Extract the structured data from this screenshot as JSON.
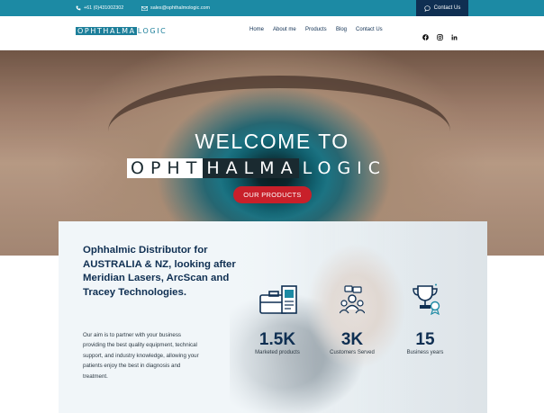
{
  "topbar": {
    "phone": "+61 (0)431002302",
    "email": "sales@ophthalmologic.com",
    "contact_button": "Contact Us"
  },
  "header": {
    "logo_dark": "OPHTHALMA",
    "logo_light": "LOGIC",
    "nav": [
      "Home",
      "About me",
      "Products",
      "Blog",
      "Contact Us"
    ],
    "social": [
      "facebook-icon",
      "instagram-icon",
      "linkedin-icon"
    ]
  },
  "hero": {
    "welcome": "WELCOME TO",
    "brand_white": "OPHT",
    "brand_dark": "HALMA",
    "brand_tail": "LOGIC",
    "cta": "OUR PRODUCTS"
  },
  "about": {
    "headline": "Ophhalmic Distributor for AUSTRALIA & NZ, looking after Meridian Lasers, ArcScan and Tracey Technologies.",
    "paragraph": "Our aim is to partner with your business providing the best quality equipment, technical support, and industry knowledge, allowing your patients enjoy the best in diagnosis and treatment."
  },
  "stats": [
    {
      "icon": "briefcase-docs-icon",
      "value": "1.5K",
      "label": "Marketed products"
    },
    {
      "icon": "customers-icon",
      "value": "3K",
      "label": "Customers Served"
    },
    {
      "icon": "trophy-icon",
      "value": "15",
      "label": "Business years"
    }
  ],
  "colors": {
    "topbar": "#1c8aa4",
    "navy": "#0f2f52",
    "cta_red": "#c8202a"
  }
}
